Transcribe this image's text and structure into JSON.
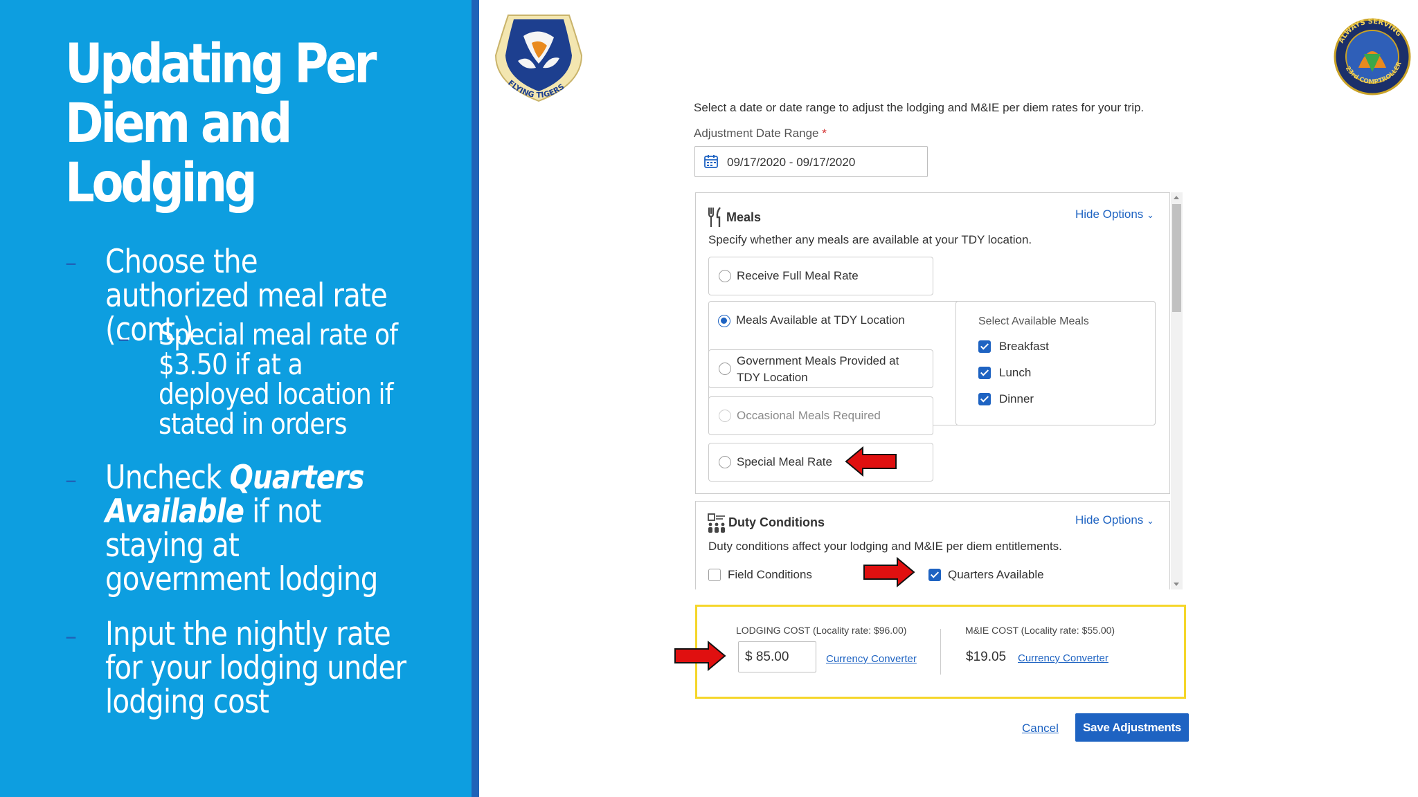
{
  "slide": {
    "title": "Updating Per Diem and Lodging",
    "bullets": {
      "b1": "Choose the authorized meal rate (cont.)",
      "b1_sub": "Special meal rate of $3.50 if at a deployed location if stated in orders",
      "b2_pre": "Uncheck ",
      "b2_em": "Quarters Available",
      "b2_post": " if not staying at government lodging",
      "b3": "Input the nightly rate for your lodging under lodging cost"
    },
    "dash_glyph": "–"
  },
  "logos": {
    "left": {
      "text": "FLYING TIGERS",
      "icon": "flying-tigers-shield-logo"
    },
    "right": {
      "top_text": "ALWAYS SERVING",
      "bottom_text": "23rd COMPTROLLER",
      "icon": "comptroller-squadron-patch-logo"
    }
  },
  "form": {
    "instruction": "Select a date or date range to adjust the lodging and M&IE per diem rates for your trip.",
    "date_range_label": "Adjustment Date Range",
    "required_mark": "*",
    "date_range_value": "09/17/2020 - 09/17/2020",
    "meals": {
      "title": "Meals",
      "hide_options": "Hide Options",
      "description": "Specify whether any meals are available at your TDY location.",
      "options": {
        "full": "Receive Full Meal Rate",
        "available": "Meals Available at TDY Location",
        "government_l1": "Government Meals Provided at",
        "government_l2": "TDY Location",
        "occasional": "Occasional Meals Required",
        "special": "Special Meal Rate"
      },
      "selected_option": "Meals Available at TDY Location",
      "select_available_label": "Select Available Meals",
      "available_meals": [
        {
          "label": "Breakfast",
          "checked": true
        },
        {
          "label": "Lunch",
          "checked": true
        },
        {
          "label": "Dinner",
          "checked": true
        }
      ]
    },
    "duty": {
      "title": "Duty Conditions",
      "hide_options": "Hide Options",
      "description": "Duty conditions affect your lodging and M&IE per diem entitlements.",
      "field_conditions": {
        "label": "Field Conditions",
        "checked": false
      },
      "quarters_available": {
        "label": "Quarters Available",
        "checked": true
      }
    },
    "costs": {
      "lodging_label": "LODGING COST",
      "lodging_locality": "(Locality rate: $96.00)",
      "lodging_value": "$ 85.00",
      "mie_label": "M&IE COST",
      "mie_locality": "(Locality rate: $55.00)",
      "mie_value": "$19.05",
      "currency_converter": "Currency Converter"
    },
    "cancel": "Cancel",
    "save": "Save Adjustments"
  },
  "colors": {
    "left_panel": "#0d9ee0",
    "stripe": "#1f63b8",
    "accent_blue": "#1e63c2",
    "highlight_border": "#f5d62a",
    "arrow_red": "#e01010"
  }
}
